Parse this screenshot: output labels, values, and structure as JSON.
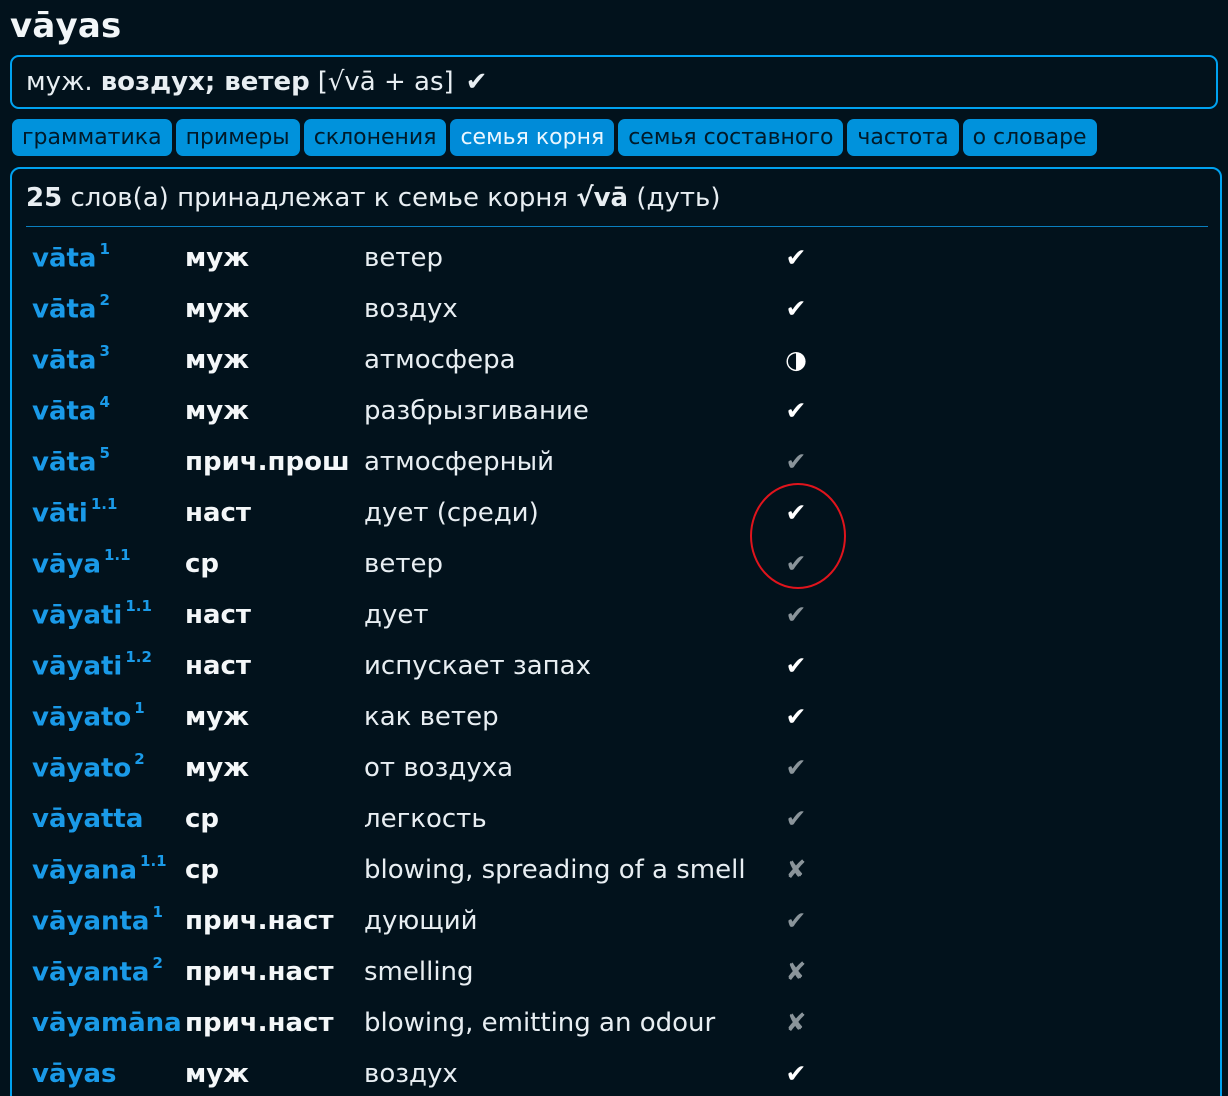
{
  "entry": {
    "headword": "vāyas",
    "pos": "муж.",
    "meaning": "воздух; ветер",
    "construction": "[√vā + as]",
    "check": "✔"
  },
  "tabs": [
    {
      "label": "грамматика",
      "active": false
    },
    {
      "label": "примеры",
      "active": false
    },
    {
      "label": "склонения",
      "active": false
    },
    {
      "label": "семья корня",
      "active": true
    },
    {
      "label": "семья составного",
      "active": false
    },
    {
      "label": "частота",
      "active": false
    },
    {
      "label": "о словаре",
      "active": false
    }
  ],
  "family": {
    "count": "25",
    "text": "слов(а) принадлежат к семье корня",
    "root": "√vā",
    "root_meaning": "(дуть)"
  },
  "rows": [
    {
      "word": "vāta",
      "sup": "1",
      "pos": "муж",
      "meaning": "ветер",
      "status": "check",
      "status_glyph": "✔"
    },
    {
      "word": "vāta",
      "sup": "2",
      "pos": "муж",
      "meaning": "воздух",
      "status": "check",
      "status_glyph": "✔"
    },
    {
      "word": "vāta",
      "sup": "3",
      "pos": "муж",
      "meaning": "атмосфера",
      "status": "half",
      "status_glyph": "◑"
    },
    {
      "word": "vāta",
      "sup": "4",
      "pos": "муж",
      "meaning": "разбрызгивание",
      "status": "check",
      "status_glyph": "✔"
    },
    {
      "word": "vāta",
      "sup": "5",
      "pos": "прич.прош",
      "meaning": "атмосферный",
      "status": "check-dim",
      "status_glyph": "✔"
    },
    {
      "word": "vāti",
      "sup": "1.1",
      "pos": "наст",
      "meaning": "дует (среди)",
      "status": "check",
      "status_glyph": "✔"
    },
    {
      "word": "vāya",
      "sup": "1.1",
      "pos": "ср",
      "meaning": "ветер",
      "status": "check-dim",
      "status_glyph": "✔"
    },
    {
      "word": "vāyati",
      "sup": "1.1",
      "pos": "наст",
      "meaning": "дует",
      "status": "check-dim",
      "status_glyph": "✔"
    },
    {
      "word": "vāyati",
      "sup": "1.2",
      "pos": "наст",
      "meaning": "испускает запах",
      "status": "check",
      "status_glyph": "✔"
    },
    {
      "word": "vāyato",
      "sup": "1",
      "pos": "муж",
      "meaning": "как ветер",
      "status": "check",
      "status_glyph": "✔"
    },
    {
      "word": "vāyato",
      "sup": "2",
      "pos": "муж",
      "meaning": "от воздуха",
      "status": "check-dim",
      "status_glyph": "✔"
    },
    {
      "word": "vāyatta",
      "sup": "",
      "pos": "ср",
      "meaning": "легкость",
      "status": "check-dim",
      "status_glyph": "✔"
    },
    {
      "word": "vāyana",
      "sup": "1.1",
      "pos": "ср",
      "meaning": "blowing, spreading of a smell",
      "status": "cross",
      "status_glyph": "✘"
    },
    {
      "word": "vāyanta",
      "sup": "1",
      "pos": "прич.наст",
      "meaning": "дующий",
      "status": "check-dim",
      "status_glyph": "✔"
    },
    {
      "word": "vāyanta",
      "sup": "2",
      "pos": "прич.наст",
      "meaning": "smelling",
      "status": "cross",
      "status_glyph": "✘"
    },
    {
      "word": "vāyamāna",
      "sup": "",
      "pos": "прич.наст",
      "meaning": "blowing, emitting an odour",
      "status": "cross",
      "status_glyph": "✘"
    },
    {
      "word": "vāyas",
      "sup": "",
      "pos": "муж",
      "meaning": "воздух",
      "status": "check",
      "status_glyph": "✔"
    }
  ],
  "colors": {
    "background": "#02121c",
    "accent": "#00a2f0",
    "tab": "#0092dc",
    "word_link": "#1a9ae8",
    "annotation": "#e0141c"
  }
}
